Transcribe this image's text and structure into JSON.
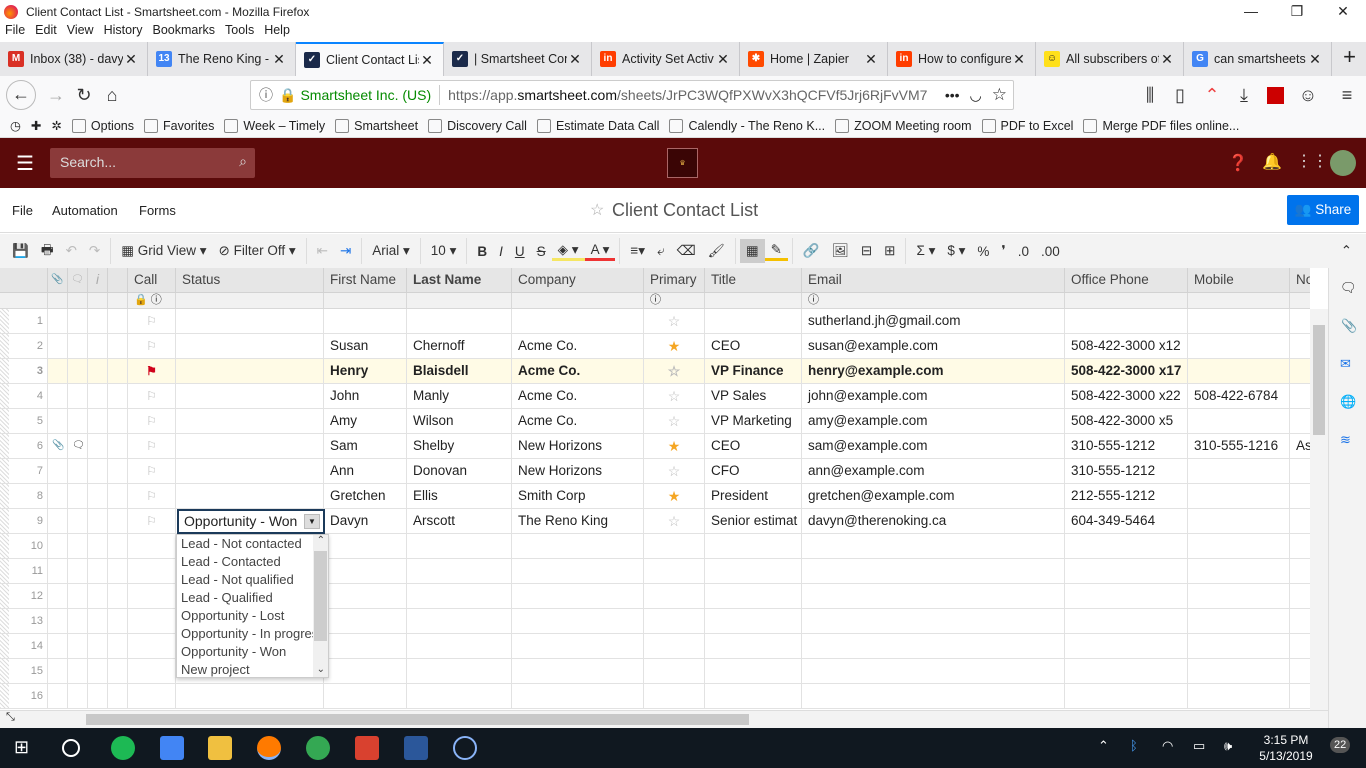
{
  "window": {
    "title": "Client Contact List - Smartsheet.com - Mozilla Firefox",
    "minimize": "—",
    "maximize": "❐",
    "close": "✕"
  },
  "menubar": [
    "File",
    "Edit",
    "View",
    "History",
    "Bookmarks",
    "Tools",
    "Help"
  ],
  "tabs": [
    {
      "label": "Inbox (38) - davy",
      "icon": "gmail-icon",
      "color": "#d93025",
      "glyph": "M"
    },
    {
      "label": "The Reno King -",
      "icon": "calendar-icon",
      "color": "#4285f4",
      "glyph": "13"
    },
    {
      "label": "Client Contact List",
      "icon": "smartsheet-icon",
      "color": "#1b2a4a",
      "glyph": "✓",
      "active": true
    },
    {
      "label": "| Smartsheet Con",
      "icon": "smartsheet-icon",
      "color": "#1b2a4a",
      "glyph": "✓"
    },
    {
      "label": "Activity Set Activ",
      "icon": "invision-icon",
      "color": "#ff3d00",
      "glyph": "in"
    },
    {
      "label": "Home | Zapier",
      "icon": "zapier-icon",
      "color": "#ff4a00",
      "glyph": "✱"
    },
    {
      "label": "How to configure",
      "icon": "invision-icon",
      "color": "#ff3d00",
      "glyph": "in"
    },
    {
      "label": "All subscribers of",
      "icon": "mailchimp-icon",
      "color": "#ffe01b",
      "glyph": "☺"
    },
    {
      "label": "can smartsheets",
      "icon": "google-icon",
      "color": "#4285f4",
      "glyph": "G"
    }
  ],
  "urlbar": {
    "identity": "Smartsheet Inc. (US)",
    "url_prefix": "https://app.",
    "url_domain": "smartsheet.com",
    "url_path": "/sheets/JrPC3WQfPXWvX3hQCFVf5Jrj6RjFvVM7"
  },
  "bookmarks": [
    "Options",
    "Favorites",
    "Week – Timely",
    "Smartsheet",
    "Discovery Call",
    "Estimate Data Call",
    "Calendly - The Reno K...",
    "ZOOM Meeting room",
    "PDF to Excel",
    "Merge PDF files online..."
  ],
  "app": {
    "search_placeholder": "Search...",
    "logo": "Reno King",
    "menu": [
      "File",
      "Automation",
      "Forms"
    ],
    "sheet_title": "Client Contact List",
    "share": "Share"
  },
  "toolbar": {
    "view": "Grid View",
    "filter": "Filter Off",
    "font": "Arial",
    "size": "10",
    "bold": "B",
    "italic": "I",
    "underline": "U",
    "strike": "S",
    "sum": "Σ",
    "currency": "$",
    "percent": "%",
    "comma": "❜",
    "dec_down": ".0",
    "dec_up": ".00"
  },
  "columns": [
    "Call",
    "Status",
    "First Name",
    "Last Name",
    "Company",
    "Primary",
    "Title",
    "Email",
    "Office Phone",
    "Mobile",
    "Notes"
  ],
  "rows": [
    {
      "n": "1",
      "flag": false,
      "star": false,
      "first": "",
      "last": "",
      "company": "",
      "title": "",
      "email": "sutherland.jh@gmail.com",
      "office": "",
      "mobile": "",
      "notes": ""
    },
    {
      "n": "2",
      "flag": false,
      "star": true,
      "first": "Susan",
      "last": "Chernoff",
      "company": "Acme Co.",
      "title": "CEO",
      "email": "susan@example.com",
      "office": "508-422-3000 x12",
      "mobile": "",
      "notes": ""
    },
    {
      "n": "3",
      "flag": true,
      "star": false,
      "bold": true,
      "highlight": true,
      "first": "Henry",
      "last": "Blaisdell",
      "company": "Acme Co.",
      "title": "VP Finance",
      "email": "henry@example.com",
      "office": "508-422-3000 x17",
      "mobile": "",
      "notes": ""
    },
    {
      "n": "4",
      "flag": false,
      "star": false,
      "first": "John",
      "last": "Manly",
      "company": "Acme Co.",
      "title": "VP Sales",
      "email": "john@example.com",
      "office": "508-422-3000 x22",
      "mobile": "508-422-6784",
      "notes": ""
    },
    {
      "n": "5",
      "flag": false,
      "star": false,
      "first": "Amy",
      "last": "Wilson",
      "company": "Acme Co.",
      "title": "VP Marketing",
      "email": "amy@example.com",
      "office": "508-422-3000 x5",
      "mobile": "",
      "notes": ""
    },
    {
      "n": "6",
      "flag": false,
      "star": true,
      "attach": true,
      "comment": true,
      "first": "Sam",
      "last": "Shelby",
      "company": "New Horizons",
      "title": "CEO",
      "email": "sam@example.com",
      "office": "310-555-1212",
      "mobile": "310-555-1216",
      "notes": "As"
    },
    {
      "n": "7",
      "flag": false,
      "star": false,
      "first": "Ann",
      "last": "Donovan",
      "company": "New Horizons",
      "title": "CFO",
      "email": "ann@example.com",
      "office": "310-555-1212",
      "mobile": "",
      "notes": ""
    },
    {
      "n": "8",
      "flag": false,
      "star": true,
      "first": "Gretchen",
      "last": "Ellis",
      "company": "Smith Corp",
      "title": "President",
      "email": "gretchen@example.com",
      "office": "212-555-1212",
      "mobile": "",
      "notes": ""
    },
    {
      "n": "9",
      "flag": false,
      "star": false,
      "first": "Davyn",
      "last": "Arscott",
      "company": "The Reno King",
      "title": "Senior estimat",
      "email": "davyn@therenoking.ca",
      "office": "604-349-5464",
      "mobile": "",
      "notes": ""
    },
    {
      "n": "10"
    },
    {
      "n": "11"
    },
    {
      "n": "12"
    },
    {
      "n": "13"
    },
    {
      "n": "14"
    },
    {
      "n": "15"
    },
    {
      "n": "16"
    }
  ],
  "status_editor": {
    "value": "Opportunity - Won",
    "options": [
      "Lead - Not contacted",
      "Lead - Contacted",
      "Lead - Not qualified",
      "Lead - Qualified",
      "Opportunity - Lost",
      "Opportunity - In progress",
      "Opportunity - Won",
      "New project"
    ]
  },
  "taskbar": {
    "time": "3:15 PM",
    "date": "5/13/2019",
    "notifications": "22"
  }
}
